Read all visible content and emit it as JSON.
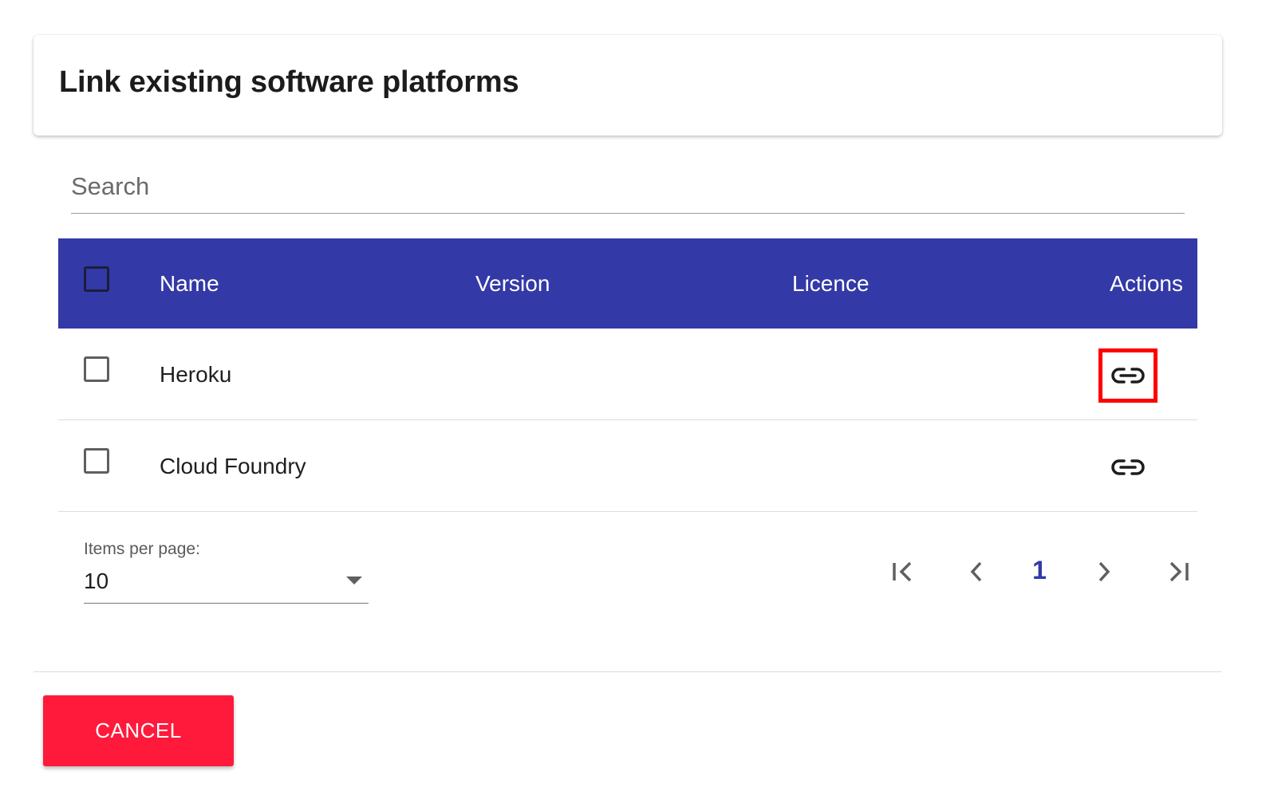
{
  "dialog": {
    "title": "Link existing software platforms"
  },
  "search": {
    "placeholder": "Search",
    "value": ""
  },
  "table": {
    "columns": [
      "Name",
      "Version",
      "Licence",
      "Actions"
    ],
    "rows": [
      {
        "name": "Heroku",
        "version": "",
        "licence": "",
        "selected": false,
        "action_icon": "link-icon",
        "highlighted": true
      },
      {
        "name": "Cloud Foundry",
        "version": "",
        "licence": "",
        "selected": false,
        "action_icon": "link-icon",
        "highlighted": false
      }
    ]
  },
  "paginator": {
    "items_per_page_label": "Items per page:",
    "items_per_page_value": "10",
    "current_page": "1",
    "icons": [
      "first-page-icon",
      "previous-page-icon",
      "next-page-icon",
      "last-page-icon"
    ]
  },
  "footer": {
    "cancel_label": "CANCEL"
  },
  "colors": {
    "header_bg": "#3339a6",
    "page_number": "#3339a6",
    "cancel_bg": "#ff1a3b",
    "highlight_border": "#ff0000"
  }
}
